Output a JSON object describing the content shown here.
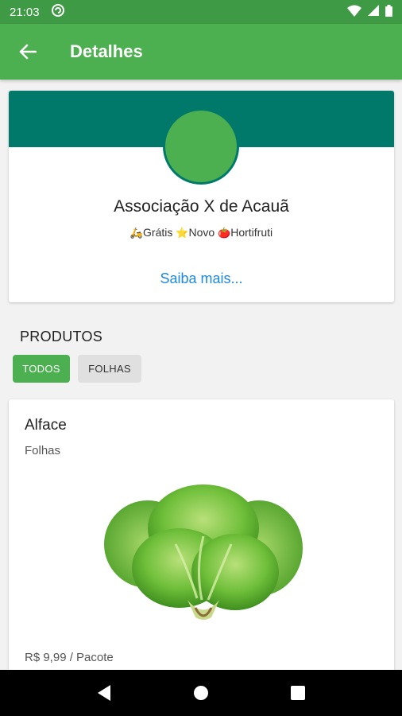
{
  "status_bar": {
    "time": "21:03"
  },
  "app_bar": {
    "title": "Detalhes"
  },
  "store": {
    "name": "Associação X de Acauã",
    "tags": [
      {
        "icon": "scooter-icon",
        "glyph": "🛵",
        "label": "Grátis"
      },
      {
        "icon": "star-icon",
        "glyph": "⭐",
        "label": "Novo"
      },
      {
        "icon": "tomato-icon",
        "glyph": "🍅",
        "label": "Hortifruti"
      }
    ],
    "more_link": "Saiba mais..."
  },
  "products_section": {
    "title": "PRODUTOS",
    "filters": [
      "TODOS",
      "FOLHAS"
    ],
    "active_filter": "TODOS"
  },
  "product": {
    "name": "Alface",
    "category": "Folhas",
    "price": "R$ 9,99 / Pacote"
  },
  "colors": {
    "app_bar": "#4caf50",
    "status_bar": "#3f9a45",
    "banner": "#00796b",
    "link": "#1e88e5"
  }
}
